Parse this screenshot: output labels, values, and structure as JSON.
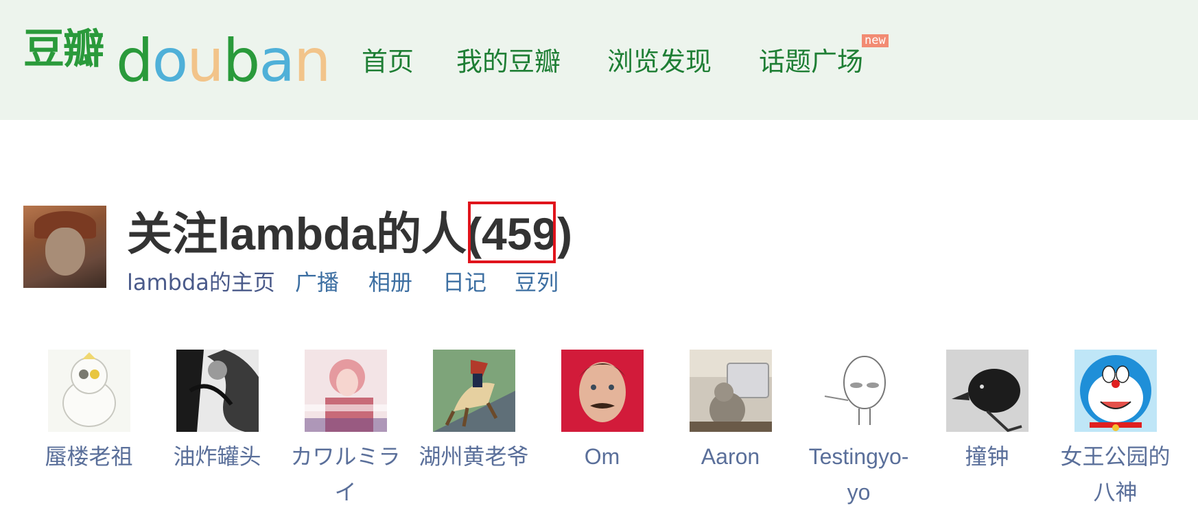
{
  "header": {
    "logo_cn": "豆瓣",
    "logo_en_letters": [
      {
        "ch": "d",
        "color": "#2a9a3b"
      },
      {
        "ch": "o",
        "color": "#4fb0d8"
      },
      {
        "ch": "u",
        "color": "#f2c48a"
      },
      {
        "ch": "b",
        "color": "#2a9a3b"
      },
      {
        "ch": "a",
        "color": "#4fb0d8"
      },
      {
        "ch": "n",
        "color": "#f2c48a"
      }
    ],
    "nav": [
      {
        "label": "首页"
      },
      {
        "label": "我的豆瓣"
      },
      {
        "label": "浏览发现"
      },
      {
        "label": "话题广场"
      }
    ],
    "new_badge": "new"
  },
  "profile": {
    "title": "关注lambda的人(459)",
    "links": [
      "lambda的主页",
      "广播",
      "相册",
      "日记",
      "豆列"
    ]
  },
  "followers": [
    {
      "name": "蜃楼老祖",
      "avatar": "cartoon-penguin"
    },
    {
      "name": "油炸罐头",
      "avatar": "bw-manga"
    },
    {
      "name": "カワルミライ",
      "avatar": "pink-hair-anime"
    },
    {
      "name": "湖州黄老爷",
      "avatar": "napoleon-horse"
    },
    {
      "name": "Om",
      "avatar": "man-red-background"
    },
    {
      "name": "Aaron",
      "avatar": "cat-at-desk"
    },
    {
      "name": "Testingyo-yo",
      "avatar": "alien-sketch"
    },
    {
      "name": "撞钟",
      "avatar": "crow-sketch"
    },
    {
      "name": "女王公园的八神",
      "avatar": "doraemon"
    }
  ]
}
